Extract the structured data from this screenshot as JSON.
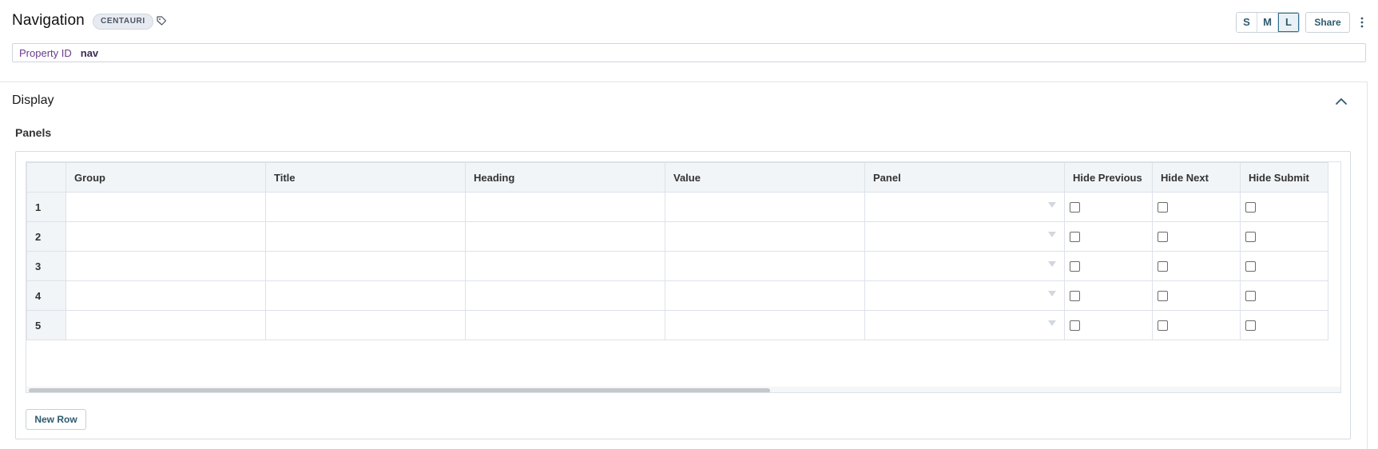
{
  "header": {
    "title": "Navigation",
    "badge": "CENTAURI",
    "size_buttons": [
      {
        "label": "S",
        "active": false
      },
      {
        "label": "M",
        "active": false
      },
      {
        "label": "L",
        "active": true
      }
    ],
    "share_label": "Share",
    "icons": {
      "tag": "tag-icon",
      "more": "more-vertical-icon"
    }
  },
  "property": {
    "label": "Property ID",
    "value": "nav"
  },
  "section": {
    "title": "Display",
    "expanded": true,
    "subsection_label": "Panels"
  },
  "grid": {
    "columns": [
      "Group",
      "Title",
      "Heading",
      "Value",
      "Panel",
      "Hide Previous",
      "Hide Next",
      "Hide Submit"
    ],
    "rows": [
      {
        "num": "1",
        "group": "",
        "title": "",
        "heading": "",
        "value": "",
        "panel": "",
        "hide_previous": false,
        "hide_next": false,
        "hide_submit": false
      },
      {
        "num": "2",
        "group": "",
        "title": "",
        "heading": "",
        "value": "",
        "panel": "",
        "hide_previous": false,
        "hide_next": false,
        "hide_submit": false
      },
      {
        "num": "3",
        "group": "",
        "title": "",
        "heading": "",
        "value": "",
        "panel": "",
        "hide_previous": false,
        "hide_next": false,
        "hide_submit": false
      },
      {
        "num": "4",
        "group": "",
        "title": "",
        "heading": "",
        "value": "",
        "panel": "",
        "hide_previous": false,
        "hide_next": false,
        "hide_submit": false
      },
      {
        "num": "5",
        "group": "",
        "title": "",
        "heading": "",
        "value": "",
        "panel": "",
        "hide_previous": false,
        "hide_next": false,
        "hide_submit": false
      }
    ],
    "new_row_label": "New Row"
  },
  "colors": {
    "accent": "#2e5a6e",
    "property_label": "#6b3a8c",
    "header_bg": "#f2f5f8"
  }
}
